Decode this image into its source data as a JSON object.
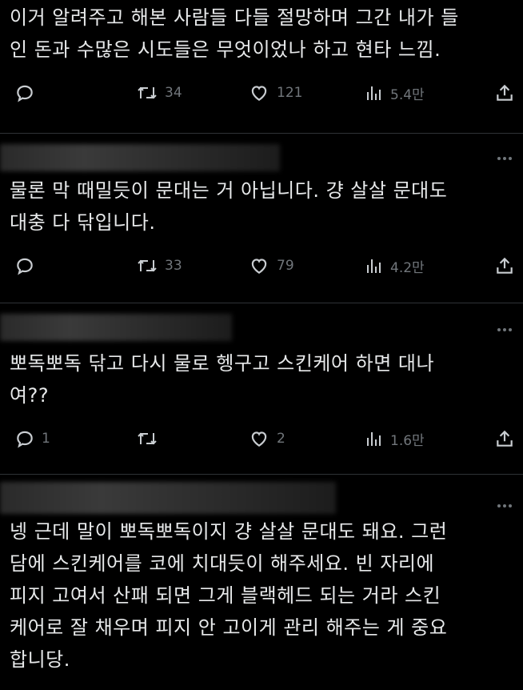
{
  "tweets": [
    {
      "text_lines": [
        "이거 알려주고 해본 사람들 다들 절망하며 그간 내가 들",
        "인 돈과 수많은 시도들은 무엇이었나 하고 현타 느낌."
      ],
      "replies": "",
      "retweets": "34",
      "likes": "121",
      "views": "5.4만"
    },
    {
      "text_lines": [
        "물론 막 때밀듯이 문대는 거 아닙니다. 걍 살살 문대도",
        "대충 다 닦입니다."
      ],
      "replies": "",
      "retweets": "33",
      "likes": "79",
      "views": "4.2만"
    },
    {
      "text_lines": [
        "뽀독뽀독 닦고 다시 물로 헹구고 스킨케어 하면 대나",
        "여??"
      ],
      "replies": "1",
      "retweets": "",
      "likes": "2",
      "views": "1.6만"
    },
    {
      "text_lines": [
        "넹 근데 말이 뽀독뽀독이지 걍 살살 문대도 돼요. 그런",
        "담에 스킨케어를 코에 치대듯이 해주세요. 빈 자리에",
        "피지 고여서 산패 되면 그게 블랙헤드 되는 거라 스킨",
        "케어로 잘 채우며 피지 안 고이게 관리 해주는 게 중요",
        "합니당."
      ]
    }
  ],
  "icons": {
    "reply": "reply-icon",
    "retweet": "retweet-icon",
    "like": "heart-icon",
    "views": "views-icon",
    "share": "share-icon",
    "more": "more-icon"
  },
  "colors": {
    "background": "#000000",
    "text": "#e7e9ea",
    "muted": "#71767b"
  }
}
